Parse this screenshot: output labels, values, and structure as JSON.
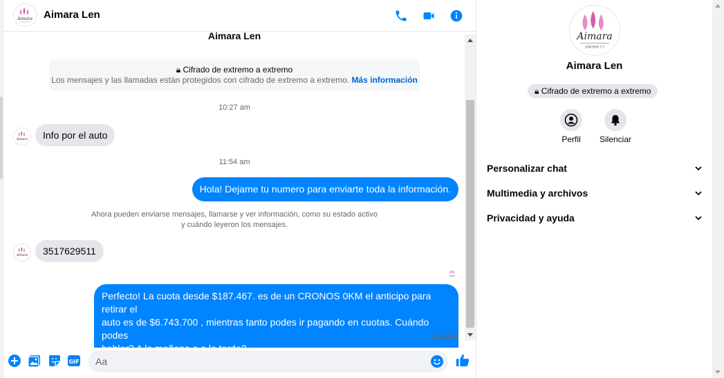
{
  "contact": {
    "name": "Aimara Len"
  },
  "colors": {
    "accent": "#0084ff",
    "link": "#0064d1",
    "bubble_in": "#e4e6eb"
  },
  "header": {
    "icons": [
      "phone-icon",
      "video-icon",
      "info-icon"
    ]
  },
  "thread": {
    "e2e_title": "Cifrado de extremo a extremo",
    "e2e_text": "Los mensajes y las llamadas están protegidos con cifrado de extremo a extremo.",
    "e2e_link": "Más información",
    "time1": "10:27 am",
    "msg1": "Info por el auto",
    "time2": "11:54 am",
    "msg2": "Hola! Dejame tu numero  para enviarte toda la información.",
    "notice_line1": "Ahora pueden enviarse mensajes, llamarse y ver información, como su estado activo",
    "notice_line2": "y cuándo leyeron los mensajes.",
    "msg3": "3517629511",
    "msg4_line1": "Perfecto! La cuota desde $187.467. es de un CRONOS 0KM el anticipo para retirar el",
    "msg4_line2": "auto es de $6.743.700 , mientras tanto podes ir pagando en cuotas. Cuándo podes",
    "msg4_line3": "hablar? A la mañana o a la tarde?",
    "status": "Enviado"
  },
  "composer": {
    "placeholder": "Aa",
    "icons": [
      "plus-icon",
      "image-icon",
      "sticker-icon",
      "gif-icon",
      "emoji-icon",
      "like-icon"
    ],
    "gif_label": "GIF"
  },
  "info_panel": {
    "e2e_pill": "Cifrado de extremo a extremo",
    "actions": [
      {
        "label": "Perfil",
        "icon": "profile-icon"
      },
      {
        "label": "Silenciar",
        "icon": "bell-icon"
      }
    ],
    "sections": [
      "Personalizar chat",
      "Multimedia y archivos",
      "Privacidad y ayuda"
    ]
  }
}
